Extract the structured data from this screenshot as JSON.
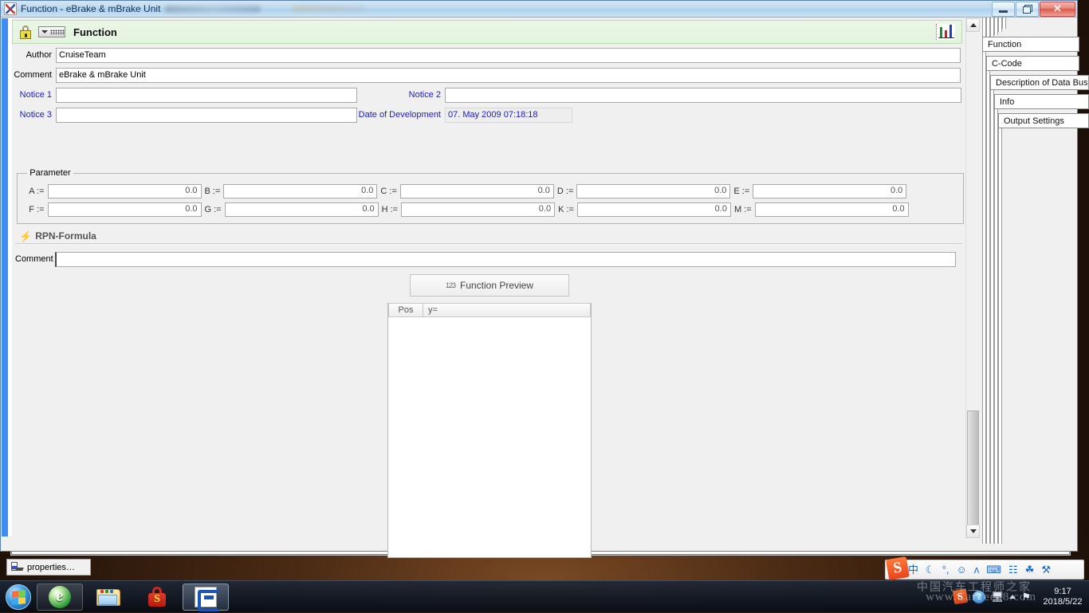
{
  "window": {
    "title": "Function - eBrake & mBrake Unit",
    "controls": {
      "minimize": "Minimize",
      "restore": "Restore",
      "close": "✕"
    }
  },
  "header": {
    "title": "Function",
    "lock_icon": "lock-icon",
    "keypad_icon": "keypad-icon",
    "chart_icon": "chart-icon"
  },
  "form": {
    "author": {
      "label": "Author",
      "value": "CruiseTeam"
    },
    "comment": {
      "label": "Comment",
      "value": "eBrake & mBrake Unit"
    },
    "notice1": {
      "label": "Notice 1",
      "value": ""
    },
    "notice2": {
      "label": "Notice 2",
      "value": ""
    },
    "notice3": {
      "label": "Notice 3",
      "value": ""
    },
    "date_of_development": {
      "label": "Date of Development",
      "value": "07. May 2009 07:18:18"
    }
  },
  "parameter": {
    "legend": "Parameter",
    "rows": [
      [
        {
          "label": "A :=",
          "value": "0.0"
        },
        {
          "label": "B :=",
          "value": "0.0"
        },
        {
          "label": "C :=",
          "value": "0.0"
        },
        {
          "label": "D :=",
          "value": "0.0"
        },
        {
          "label": "E :=",
          "value": "0.0"
        }
      ],
      [
        {
          "label": "F :=",
          "value": "0.0"
        },
        {
          "label": "G :=",
          "value": "0.0"
        },
        {
          "label": "H :=",
          "value": "0.0"
        },
        {
          "label": "K :=",
          "value": "0.0"
        },
        {
          "label": "M :=",
          "value": "0.0"
        }
      ]
    ]
  },
  "rpn": {
    "section_title": "RPN-Formula",
    "bolt_icon": "⚡",
    "comment_label": "Comment",
    "comment_value": "",
    "preview_button": "Function Preview",
    "preview_icon": "123"
  },
  "results_table": {
    "columns": [
      "Pos",
      "y="
    ],
    "rows": []
  },
  "scrollbar": {
    "up": "▲",
    "down": "▼"
  },
  "tabs": [
    {
      "label": "Function"
    },
    {
      "label": "C-Code"
    },
    {
      "label": "Description of Data Bus"
    },
    {
      "label": "Info"
    },
    {
      "label": "Output Settings"
    }
  ],
  "properties_window": {
    "label": "properties…"
  },
  "taskbar": {
    "start": "Start",
    "items": [
      {
        "name": "internet-explorer",
        "state": "hover"
      },
      {
        "name": "windows-explorer",
        "state": "normal"
      },
      {
        "name": "sogou-lock",
        "state": "normal"
      },
      {
        "name": "can-tool",
        "state": "active"
      }
    ],
    "tray": {
      "sogou": "S",
      "help": "?",
      "show_hidden": "▲",
      "clock_time": "9:17",
      "clock_date": "2018/5/22"
    }
  },
  "ime_toolbar": {
    "logo": "S",
    "icons": [
      "中",
      "☾",
      "°,",
      "☺",
      "ᴧ",
      "⌨",
      "☷",
      "☘",
      "⚒"
    ]
  },
  "watermark": {
    "line1": "中国汽车工程师之家",
    "line2": "www.CarTech8.com"
  },
  "colors": {
    "title_bar": "#bdd8f0",
    "header_green": "#eaf7e6",
    "label_blue": "#1a1acc",
    "left_strip": "#3d8df5"
  }
}
